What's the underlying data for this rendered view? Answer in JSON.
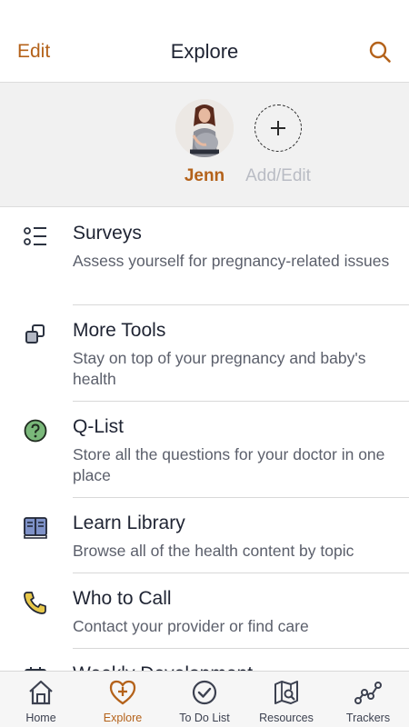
{
  "header": {
    "edit_label": "Edit",
    "title": "Explore",
    "search_icon": "search-icon"
  },
  "profiles": {
    "primary": {
      "name": "Jenn"
    },
    "add_label": "Add/Edit"
  },
  "list": {
    "items": [
      {
        "title": "Surveys",
        "desc": "Assess yourself for pregnancy-related issues",
        "icon": "checklist-icon"
      },
      {
        "title": "More Tools",
        "desc": "Stay on top of your pregnancy and baby's health",
        "icon": "tools-icon"
      },
      {
        "title": "Q-List",
        "desc": "Store all the questions for your doctor in one place",
        "icon": "question-icon"
      },
      {
        "title": "Learn Library",
        "desc": "Browse all of the health content by topic",
        "icon": "book-icon"
      },
      {
        "title": "Who to Call",
        "desc": "Contact your provider or find care",
        "icon": "phone-icon"
      },
      {
        "title": "Weekly Development",
        "desc": "",
        "icon": "calendar-icon"
      }
    ]
  },
  "tabs": [
    {
      "label": "Home",
      "icon": "home-icon",
      "active": false
    },
    {
      "label": "Explore",
      "icon": "heart-plus-icon",
      "active": true
    },
    {
      "label": "To Do List",
      "icon": "check-circle-icon",
      "active": false
    },
    {
      "label": "Resources",
      "icon": "map-search-icon",
      "active": false
    },
    {
      "label": "Trackers",
      "icon": "trend-icon",
      "active": false
    }
  ],
  "colors": {
    "accent": "#b4621a",
    "text": "#1f2433",
    "muted": "#5b5f6b",
    "profile_bg": "#f1f1f1"
  }
}
